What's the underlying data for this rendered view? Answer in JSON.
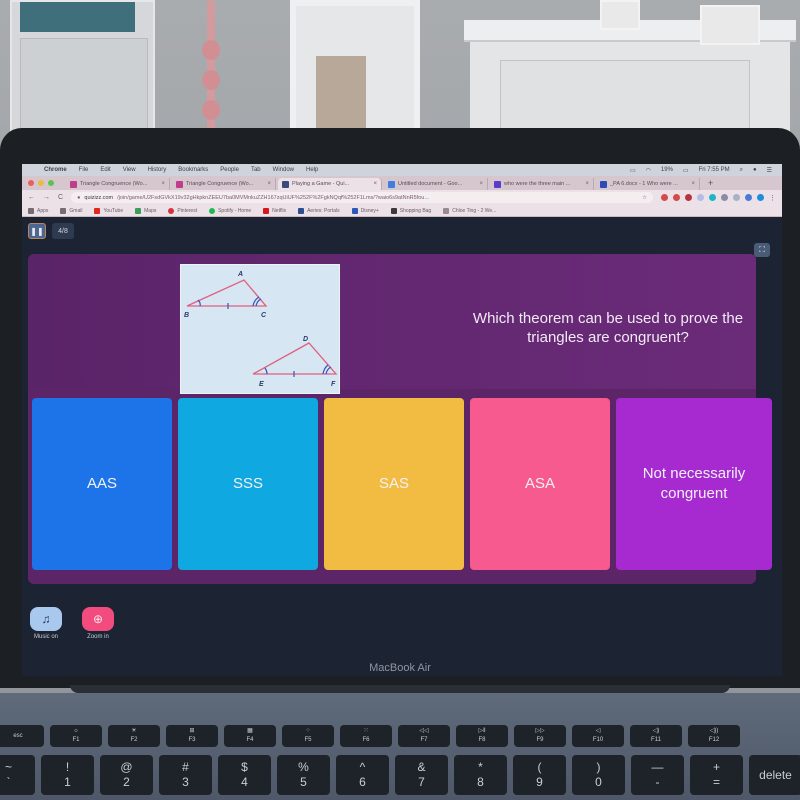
{
  "mac_menubar": {
    "app": "Chrome",
    "menus": [
      "File",
      "Edit",
      "View",
      "History",
      "Bookmarks",
      "People",
      "Tab",
      "Window",
      "Help"
    ],
    "battery": "19%",
    "clock": "Fri 7:55 PM"
  },
  "browser": {
    "tabs": [
      {
        "label": "Triangle Congruence (Wo...",
        "icon": "quizizz-icon",
        "color": "#c23c8c",
        "active": false
      },
      {
        "label": "Triangle Congruence (Wo...",
        "icon": "quizizz-icon",
        "color": "#c23c8c",
        "active": false
      },
      {
        "label": "Playing a Game - Qui...",
        "icon": "quizizz-game-icon",
        "color": "#3a4a7a",
        "active": true
      },
      {
        "label": "Untitled document - Goo...",
        "icon": "google-docs-icon",
        "color": "#3d7ee0",
        "active": false
      },
      {
        "label": "who were the three main ...",
        "icon": "brainly-icon",
        "color": "#5b3ccf",
        "active": false
      },
      {
        "label": "_PA 6.docx - 1 Who were ...",
        "icon": "shield-icon",
        "color": "#2b4bb8",
        "active": false
      }
    ],
    "url_domain": "quizizz.com",
    "url_path": "/join/game/U2FsdGVkX19v32gHkpknZEEU7ba0MVMnkuZZH167zqUiUF%252F%2FgkNQqf%252F1Lms/?waio6s9atNnR5fou...",
    "bookmarks": [
      {
        "label": "Apps",
        "color": "#7a6a74"
      },
      {
        "label": "Gmail",
        "color": "#7a6a74"
      },
      {
        "label": "YouTube",
        "color": "#e0261f"
      },
      {
        "label": "Maps",
        "color": "#3a9d5c"
      },
      {
        "label": "Pinterest",
        "color": "#d8303c"
      },
      {
        "label": "Spotify - Home",
        "color": "#1eb954"
      },
      {
        "label": "Netflix",
        "color": "#d8161f"
      },
      {
        "label": "Aeries: Portals",
        "color": "#2e4f8f"
      },
      {
        "label": "Disney+",
        "color": "#2d57b8"
      },
      {
        "label": "Shopping Bag",
        "color": "#3a3a3a"
      },
      {
        "label": "Chloe Ting - 2 We...",
        "color": "#9a8a90"
      }
    ]
  },
  "quiz": {
    "question_counter": "4/8",
    "question": "Which theorem can be used to prove the triangles are congruent?",
    "diagram_labels": {
      "a": "A",
      "b": "B",
      "c": "C",
      "d": "D",
      "e": "E",
      "f": "F"
    },
    "options": [
      {
        "label": "AAS",
        "color": "#1d74e8"
      },
      {
        "label": "SSS",
        "color": "#10a8e0"
      },
      {
        "label": "SAS",
        "color": "#f2bc42"
      },
      {
        "label": "ASA",
        "color": "#f75a8f"
      },
      {
        "label": "Not necessarily congruent",
        "color": "#a62ad0"
      }
    ],
    "controls": {
      "music_label": "Music on",
      "music_color": "#a9c8ee",
      "zoom_label": "Zoom in",
      "zoom_color": "#f24c7e"
    }
  },
  "laptop": {
    "brand": "MacBook Air",
    "function_keys": [
      {
        "top": "",
        "bottom": "esc"
      },
      {
        "top": "☼",
        "bottom": "F1"
      },
      {
        "top": "☀",
        "bottom": "F2"
      },
      {
        "top": "⊞",
        "bottom": "F3"
      },
      {
        "top": "▦",
        "bottom": "F4"
      },
      {
        "top": "⁘",
        "bottom": "F5"
      },
      {
        "top": "⁙",
        "bottom": "F6"
      },
      {
        "top": "◁◁",
        "bottom": "F7"
      },
      {
        "top": "▷‖",
        "bottom": "F8"
      },
      {
        "top": "▷▷",
        "bottom": "F9"
      },
      {
        "top": "◁",
        "bottom": "F10"
      },
      {
        "top": "◁)",
        "bottom": "F11"
      },
      {
        "top": "◁))",
        "bottom": "F12"
      }
    ],
    "number_keys": [
      {
        "top": "~",
        "bottom": "`"
      },
      {
        "top": "!",
        "bottom": "1"
      },
      {
        "top": "@",
        "bottom": "2"
      },
      {
        "top": "#",
        "bottom": "3"
      },
      {
        "top": "$",
        "bottom": "4"
      },
      {
        "top": "%",
        "bottom": "5"
      },
      {
        "top": "^",
        "bottom": "6"
      },
      {
        "top": "&",
        "bottom": "7"
      },
      {
        "top": "*",
        "bottom": "8"
      },
      {
        "top": "(",
        "bottom": "9"
      },
      {
        "top": ")",
        "bottom": "0"
      },
      {
        "top": "—",
        "bottom": "-"
      },
      {
        "top": "+",
        "bottom": "="
      },
      {
        "top": "",
        "bottom": "delete"
      }
    ]
  }
}
